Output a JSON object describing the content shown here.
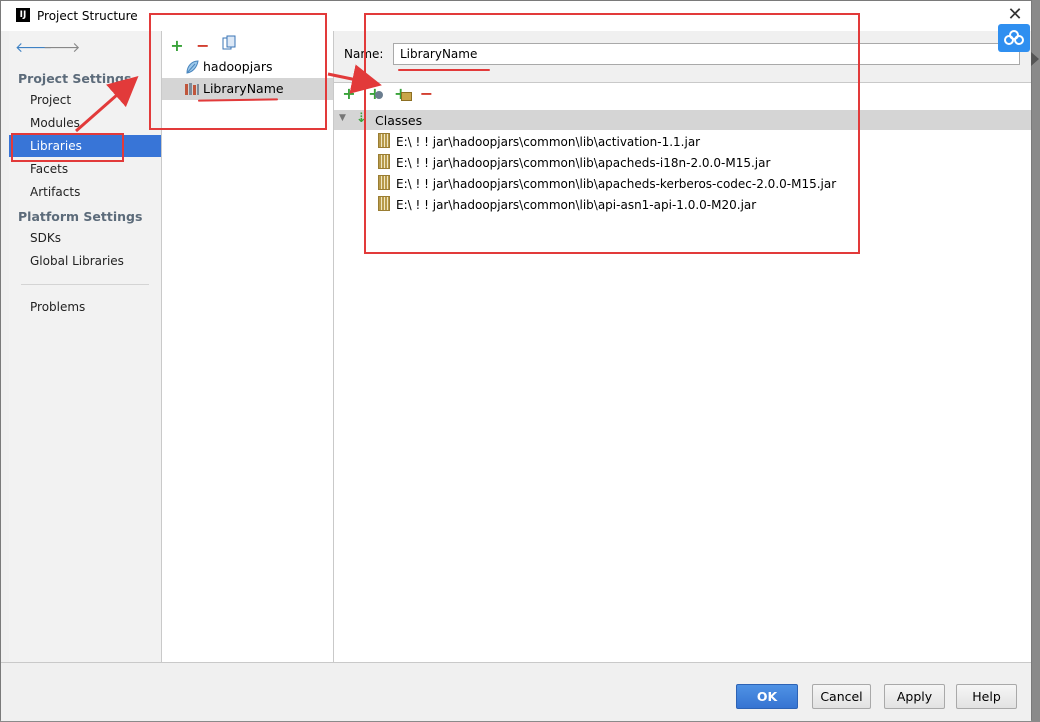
{
  "window": {
    "title": "Project Structure",
    "app_icon_text": "IJ"
  },
  "nav": {
    "sections": [
      {
        "title": "Project Settings"
      },
      {
        "title": "Platform Settings"
      }
    ],
    "items": [
      {
        "label": "Project"
      },
      {
        "label": "Modules"
      },
      {
        "label": "Libraries"
      },
      {
        "label": "Facets"
      },
      {
        "label": "Artifacts"
      },
      {
        "label": "SDKs"
      },
      {
        "label": "Global Libraries"
      },
      {
        "label": "Problems"
      }
    ],
    "selected": "Libraries"
  },
  "libraries": {
    "items": [
      {
        "label": "hadoopjars",
        "icon": "leaf-icon"
      },
      {
        "label": "LibraryName",
        "icon": "library-icon"
      }
    ],
    "selected": "LibraryName"
  },
  "detail": {
    "name_label": "Name:",
    "name_value": "LibraryName",
    "tree_root": "Classes",
    "jars": [
      "E:\\ ! ! jar\\hadoopjars\\common\\lib\\activation-1.1.jar",
      "E:\\ ! ! jar\\hadoopjars\\common\\lib\\apacheds-i18n-2.0.0-M15.jar",
      "E:\\ ! ! jar\\hadoopjars\\common\\lib\\apacheds-kerberos-codec-2.0.0-M15.jar",
      "E:\\ ! ! jar\\hadoopjars\\common\\lib\\api-asn1-api-1.0.0-M20.jar"
    ]
  },
  "buttons": {
    "ok": "OK",
    "cancel": "Cancel",
    "apply": "Apply",
    "help": "Help"
  },
  "colors": {
    "selection": "#3875d7",
    "annotation": "#e23a3a",
    "add": "#39a33a",
    "remove": "#d23b2c"
  }
}
